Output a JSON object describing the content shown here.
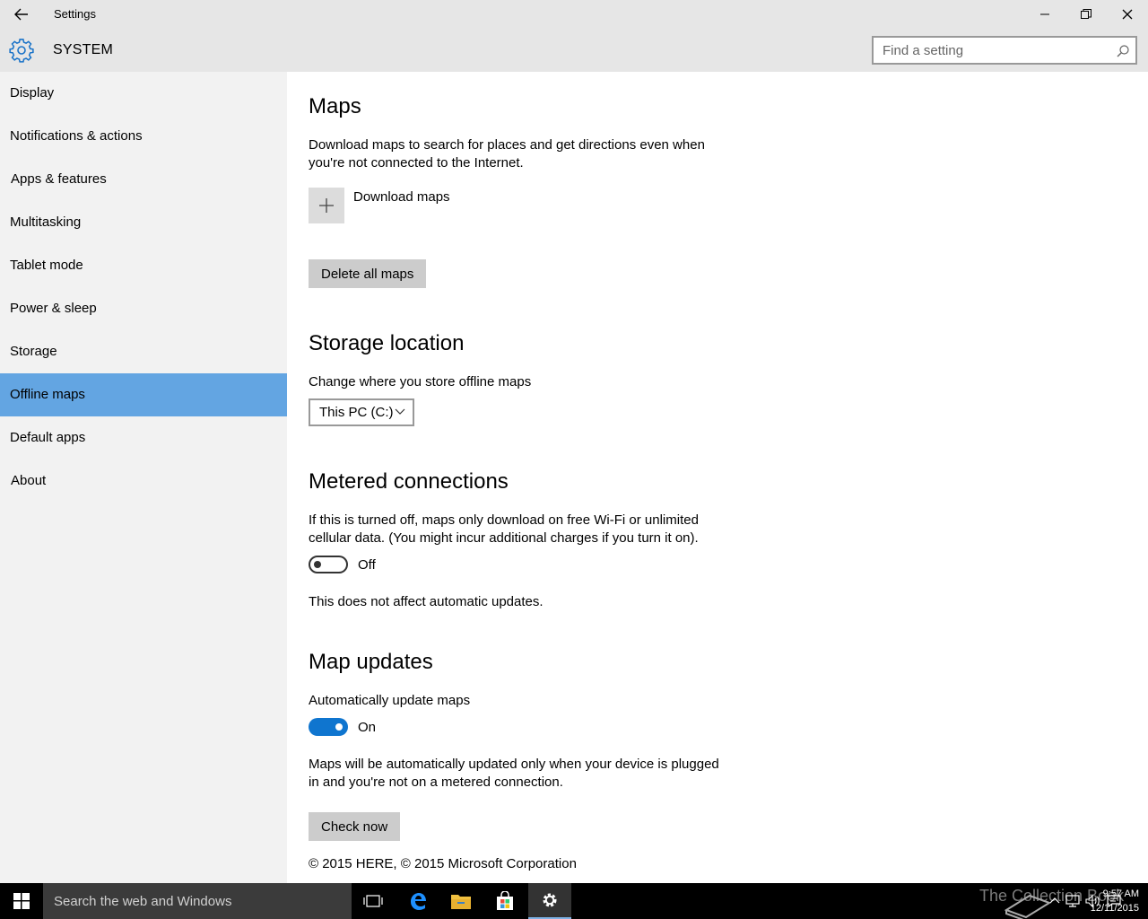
{
  "window": {
    "title": "Settings",
    "section_title": "SYSTEM",
    "search_placeholder": "Find a setting"
  },
  "sidebar": {
    "items": [
      {
        "label": "Display"
      },
      {
        "label": "Notifications & actions"
      },
      {
        "label": "Apps & features"
      },
      {
        "label": "Multitasking"
      },
      {
        "label": "Tablet mode"
      },
      {
        "label": "Power & sleep"
      },
      {
        "label": "Storage"
      },
      {
        "label": "Offline maps",
        "selected": true
      },
      {
        "label": "Default apps"
      },
      {
        "label": "About"
      }
    ]
  },
  "maps": {
    "heading": "Maps",
    "description": "Download maps to search for places and get directions even when you're not connected to the Internet.",
    "download_label": "Download maps",
    "delete_button": "Delete all maps"
  },
  "storage": {
    "heading": "Storage location",
    "description": "Change where you store offline maps",
    "selected_location": "This PC (C:)"
  },
  "metered": {
    "heading": "Metered connections",
    "description": "If this is turned off, maps only download on free Wi-Fi or unlimited cellular data. (You might incur additional charges if you turn it on).",
    "toggle_state": "Off",
    "note": "This does not affect automatic updates."
  },
  "updates": {
    "heading": "Map updates",
    "auto_label": "Automatically update maps",
    "toggle_state": "On",
    "description": "Maps will be automatically updated only when your device is plugged in and you're not on a metered connection.",
    "check_button": "Check now",
    "copyright": "© 2015 HERE, © 2015 Microsoft Corporation"
  },
  "taskbar": {
    "search_placeholder": "Search the web and Windows",
    "time": "9:57 AM",
    "date": "12/11/2015",
    "watermark": "The Collection Book"
  },
  "colors": {
    "accent": "#0f75cf",
    "selected_nav": "#63a5e2",
    "titlebar": "#e6e6e6",
    "sidebar": "#f2f2f2"
  }
}
